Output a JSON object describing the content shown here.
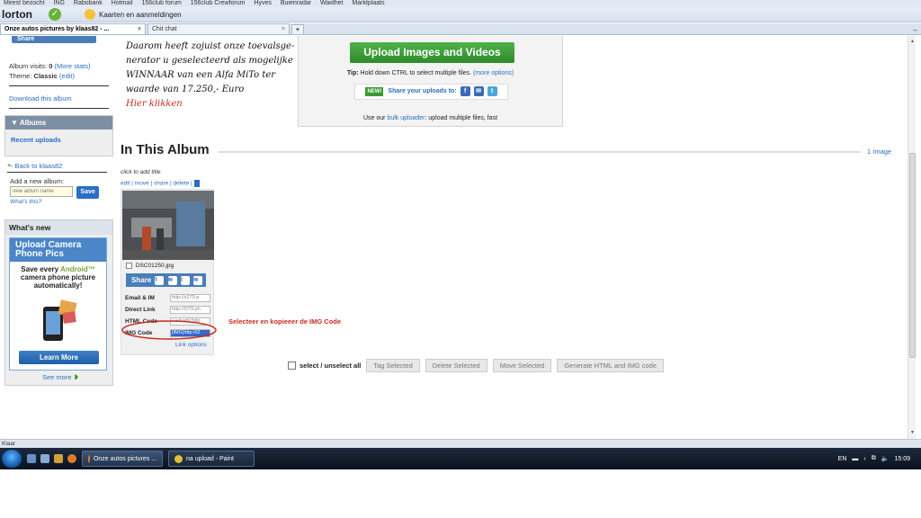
{
  "browser": {
    "bookmarks": [
      "Meest bezocht",
      "ING",
      "Rabobank",
      "Hotmail",
      "156club forum",
      "156club Crewforum",
      "Hyves",
      "Buienradar",
      "Waidhet",
      "Marktplaats"
    ],
    "toolbar_brand": "lorton",
    "toolbar_map_label": "Kaarten en aanmeldingen",
    "tab_active": "Onze autos pictures by klaas82 - ...",
    "tab_second": "Chit chat",
    "tab_close": "×",
    "new_tab": "+",
    "status_text": "Klaar"
  },
  "sidebar": {
    "share_strip": "Share",
    "album_visits_label": "Album visits:",
    "album_visits_value": "0",
    "more_stats": "(More stats)",
    "theme_label": "Theme:",
    "theme_value": "Classic",
    "theme_edit": "(edit)",
    "download_album": "Download this album",
    "albums_header": "Albums",
    "recent_uploads": "Recent uploads",
    "back_link": "Back to klaas82",
    "new_album_label": "Add a new album:",
    "new_album_placeholder": "new album name",
    "save_label": "Save",
    "whats_this": "What's this?",
    "whats_new_header": "What's new",
    "promo_title": "Upload Camera Phone Pics",
    "promo_line1": "Save every",
    "promo_android": "Android™",
    "promo_line2": "camera phone picture automatically!",
    "learn_more": "Learn More",
    "see_more": "See more"
  },
  "note": {
    "line1": "Daarom heeft zojuist onze toevalsge-",
    "line2": "nerator u geselecteerd als mogelijke",
    "line3": "WINNAAR van een Alfa MiTo ter",
    "line4": "waarde van 17.250,- Euro",
    "click_here": "Hier klikken"
  },
  "upload": {
    "button": "Upload Images and Videos",
    "tip_prefix": "Tip:",
    "tip_text": "Hold down CTRL to select multiple files.",
    "more_options": "(more options)",
    "new_badge": "NEW!",
    "share_uploads": "Share your uploads to:",
    "bulk_prefix": "Use our",
    "bulk_link": "bulk uploader",
    "bulk_suffix": ": upload multiple files, fast"
  },
  "album": {
    "title": "In This Album",
    "image_count": "1 Image",
    "click_to_add_title": "click to add title",
    "actions_links": "edit | move | share | delete |",
    "filename": "DSC01250.jpg",
    "share_label": "Share",
    "link_rows": [
      {
        "label": "Email & IM",
        "value": "http://s279.p"
      },
      {
        "label": "Direct Link",
        "value": "http://i279.ph"
      },
      {
        "label": "HTML Code",
        "value": "<a href=\"http"
      },
      {
        "label": "IMG Code",
        "value": "[IMG]http://i2"
      }
    ],
    "link_options": "Link options",
    "instruction": "Selecteer en kopieeer de IMG Code",
    "select_all": "select / unselect all",
    "buttons": [
      "Tag Selected",
      "Delete Selected",
      "Move Selected",
      "Generate HTML and IMG code"
    ]
  },
  "taskbar": {
    "task1": "Onze autos pictures ...",
    "task2": "na upload - Paint",
    "lang": "EN",
    "time": "15:09"
  },
  "colors": {
    "link": "#2a6fc4",
    "upload_green": "#3a9a2f",
    "annotation_red": "#c82a1e"
  }
}
